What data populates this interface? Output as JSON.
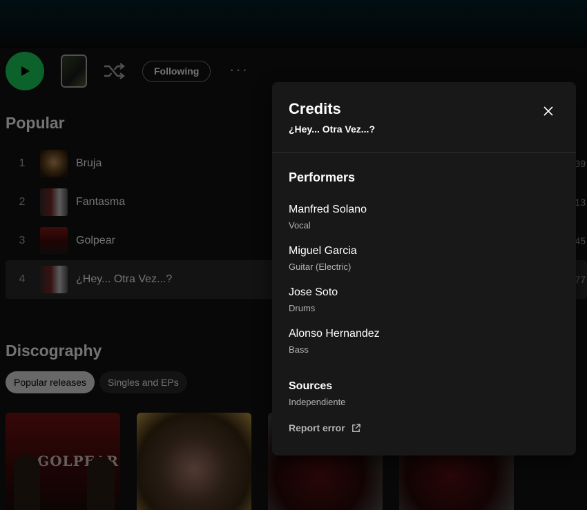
{
  "actions": {
    "following_label": "Following",
    "more_label": "···"
  },
  "popular": {
    "title": "Popular",
    "tracks": [
      {
        "num": "1",
        "title": "Bruja",
        "plays": "39"
      },
      {
        "num": "2",
        "title": "Fantasma",
        "plays": "13"
      },
      {
        "num": "3",
        "title": "Golpear",
        "plays": "45"
      },
      {
        "num": "4",
        "title": "¿Hey... Otra Vez...?",
        "plays": "77"
      }
    ]
  },
  "discography": {
    "title": "Discography",
    "filters": [
      "Popular releases",
      "Singles and EPs"
    ],
    "albums": [
      {
        "cover_text": "GOLPEAR"
      }
    ]
  },
  "credits_modal": {
    "title": "Credits",
    "subtitle": "¿Hey... Otra Vez...?",
    "performers_heading": "Performers",
    "performers": [
      {
        "name": "Manfred Solano",
        "role": "Vocal"
      },
      {
        "name": "Miguel Garcia",
        "role": "Guitar (Electric)"
      },
      {
        "name": "Jose Soto",
        "role": "Drums"
      },
      {
        "name": "Alonso Hernandez",
        "role": "Bass"
      }
    ],
    "sources_heading": "Sources",
    "sources_value": "Independiente",
    "report_label": "Report error"
  },
  "colors": {
    "accent": "#1ed760",
    "background": "#121212",
    "modal": "#181818"
  },
  "icons": [
    "play-icon",
    "shuffle-icon",
    "close-icon",
    "external-link-icon"
  ]
}
